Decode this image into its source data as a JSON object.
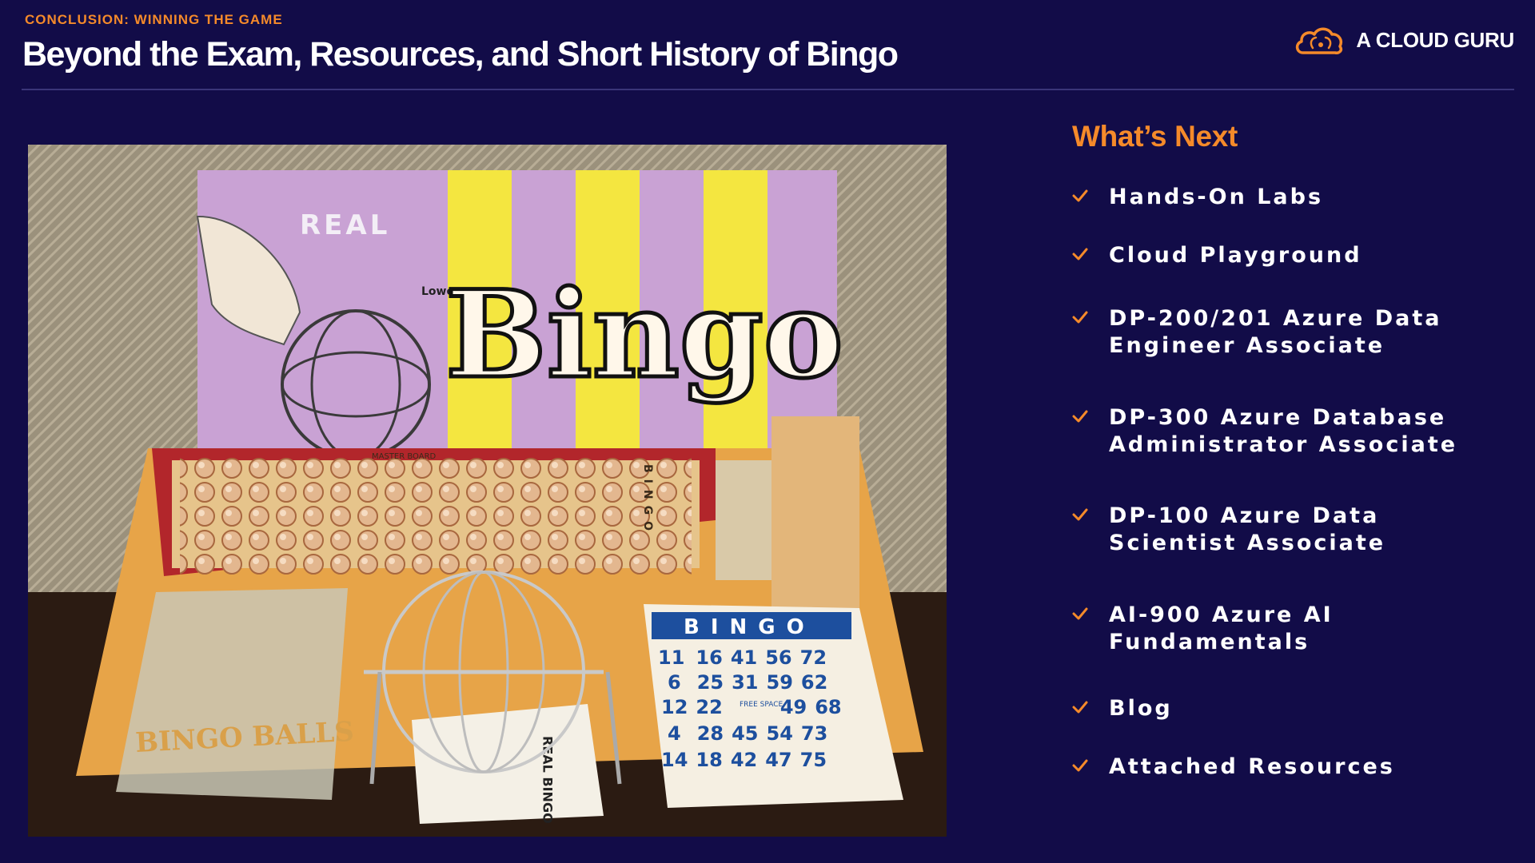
{
  "header": {
    "eyebrow": "CONCLUSION: WINNING THE GAME",
    "title": "Beyond the Exam, Resources, and Short History of Bingo"
  },
  "brand": {
    "name": "A CLOUD GURU",
    "icon": "cloud-logo-icon",
    "accent_color": "#f58a2a"
  },
  "photo": {
    "box_text_real": "REAL",
    "box_text_lowe": "Lowe",
    "box_text_bingo": "Bingo",
    "board_text": "MASTER BOARD",
    "board_side_text": "BINGO",
    "bag_text": "BINGO BALLS",
    "instructions_text": "REAL BINGO",
    "card_header": "BINGO",
    "card_free": "FREE SPACE",
    "card_rows": [
      [
        "11",
        "16",
        "41",
        "56",
        "72"
      ],
      [
        "6",
        "25",
        "31",
        "59",
        "62"
      ],
      [
        "12",
        "22",
        "",
        "49",
        "68"
      ],
      [
        "4",
        "28",
        "45",
        "54",
        "73"
      ],
      [
        "14",
        "18",
        "42",
        "47",
        "75"
      ]
    ]
  },
  "sidebar": {
    "heading": "What’s Next",
    "check_icon": "checkmark-icon",
    "items": [
      {
        "label": "Hands-On Labs"
      },
      {
        "label": "Cloud Playground"
      },
      {
        "label": "DP-200/201 Azure Data Engineer Associate"
      },
      {
        "label": "DP-300 Azure Database Administrator Associate"
      },
      {
        "label": "DP-100 Azure Data Scientist Associate"
      },
      {
        "label": "AI-900 Azure AI Fundamentals"
      },
      {
        "label": "Blog"
      },
      {
        "label": "Attached Resources"
      }
    ]
  },
  "colors": {
    "background": "#120c48",
    "accent": "#f58a2a",
    "text": "#ffffff"
  }
}
